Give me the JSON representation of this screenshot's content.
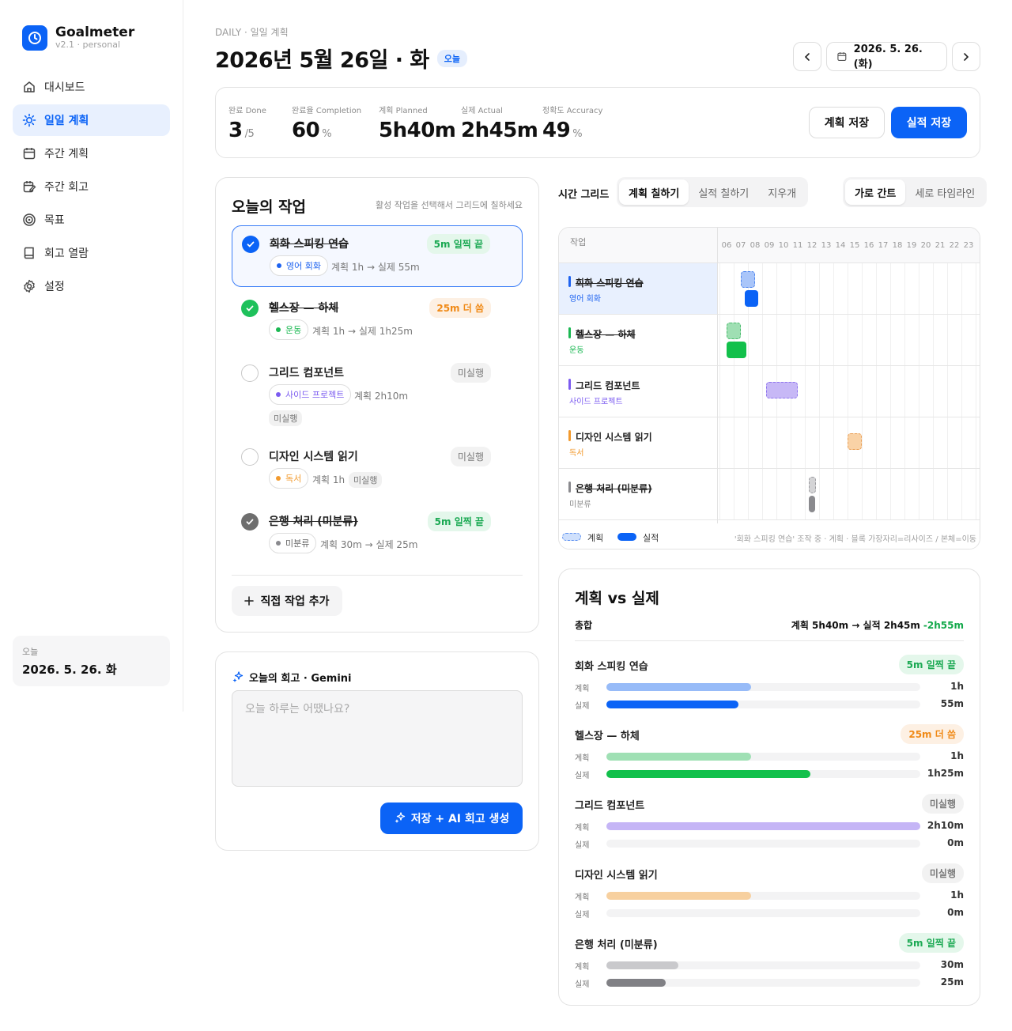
{
  "sidebar": {
    "brand": "Goalmeter",
    "version": "v2.1 · personal",
    "nav": [
      "대시보드",
      "일일 계획",
      "주간 계획",
      "주간 회고",
      "목표",
      "회고 열람",
      "설정"
    ],
    "today_label": "오늘",
    "today_date": "2026. 5. 26. 화"
  },
  "header": {
    "breadcrumb": "DAILY · 일일 계획",
    "title": "2026년 5월 26일 · 화",
    "today_pill": "오늘",
    "date_button": "2026. 5. 26. (화)"
  },
  "stats": {
    "done_label": "완료 Done",
    "done_value": "3",
    "done_total": "/5",
    "completion_label": "완료율 Completion",
    "completion_value": "60",
    "completion_unit": "%",
    "planned_label": "계획 Planned",
    "planned_value": "5h40m",
    "actual_label": "실제 Actual",
    "actual_value": "2h45m",
    "accuracy_label": "정확도 Accuracy",
    "accuracy_value": "49",
    "accuracy_unit": "%",
    "save_plan": "계획 저장",
    "save_actual": "실적 저장"
  },
  "tasks": {
    "title": "오늘의 작업",
    "hint": "활성 작업을 선택해서 그리드에 칠하세요",
    "add_button": "직접 작업 추가",
    "items": [
      {
        "name": "회화 스피킹 연습",
        "badge": "5m 일찍 끝",
        "category": "영어 회화",
        "meta": "계획 1h → 실제 55m"
      },
      {
        "name": "헬스장 — 하체",
        "badge": "25m 더 씀",
        "category": "운동",
        "meta": "계획 1h → 실제 1h25m"
      },
      {
        "name": "그리드 컴포넌트",
        "badge": "미실행",
        "category": "사이드 프로젝트",
        "meta": "계획 2h10m",
        "meta2": "미실행"
      },
      {
        "name": "디자인 시스템 읽기",
        "badge": "미실행",
        "category": "독서",
        "meta": "계획 1h",
        "meta2": "미실행"
      },
      {
        "name": "은행 처리 (미분류)",
        "badge": "5m 일찍 끝",
        "category": "미분류",
        "meta": "계획 30m → 실제 25m"
      }
    ]
  },
  "retro": {
    "title": "오늘의 회고 · Gemini",
    "placeholder": "오늘 하루는 어땠나요?",
    "button": "저장 + AI 회고 생성"
  },
  "grid": {
    "label": "시간 그리드",
    "modes": [
      "계획 칠하기",
      "실적 칠하기",
      "지우개"
    ],
    "views": [
      "가로 간트",
      "세로 타임라인"
    ],
    "task_col": "작업",
    "hours": [
      "06",
      "07",
      "08",
      "09",
      "10",
      "11",
      "12",
      "13",
      "14",
      "15",
      "16",
      "17",
      "18",
      "19",
      "20",
      "21",
      "22",
      "23"
    ],
    "legend_plan": "계획",
    "legend_actual": "실적",
    "note": "'회화 스피킹 연습' 조작 중 · 계획 · 블록 가장자리=리사이즈 / 본체=이동",
    "rows": [
      {
        "name": "회화 스피킹 연습",
        "category": "영어 회화",
        "plan": [
          7.5,
          8.5
        ],
        "actual": [
          7.75,
          8.7
        ]
      },
      {
        "name": "헬스장 — 하체",
        "category": "운동",
        "plan": [
          6.5,
          7.5
        ],
        "actual": [
          6.5,
          7.9
        ]
      },
      {
        "name": "그리드 컴포넌트",
        "category": "사이드 프로젝트",
        "plan": [
          9.25,
          11.5
        ],
        "actual": null
      },
      {
        "name": "디자인 시스템 읽기",
        "category": "독서",
        "plan": [
          15.0,
          16.0
        ],
        "actual": null
      },
      {
        "name": "은행 처리 (미분류)",
        "category": "미분류",
        "plan": [
          12.25,
          12.75
        ],
        "actual": [
          12.25,
          12.7
        ]
      }
    ]
  },
  "comparison": {
    "title": "계획 vs 실제",
    "total_label": "총합",
    "total_text": "계획 5h40m → 실적 2h45m",
    "total_diff": "-2h55m",
    "plan_label": "계획",
    "actual_label": "실제",
    "items": [
      {
        "name": "회화 스피킹 연습",
        "badge": "5m 일찍 끝",
        "plan_value": "1h",
        "actual_value": "55m",
        "plan_frac": 0.46,
        "actual_frac": 0.42
      },
      {
        "name": "헬스장 — 하체",
        "badge": "25m 더 씀",
        "plan_value": "1h",
        "actual_value": "1h25m",
        "plan_frac": 0.46,
        "actual_frac": 0.65
      },
      {
        "name": "그리드 컴포넌트",
        "badge": "미실행",
        "plan_value": "2h10m",
        "actual_value": "0m",
        "plan_frac": 1.0,
        "actual_frac": 0.0
      },
      {
        "name": "디자인 시스템 읽기",
        "badge": "미실행",
        "plan_value": "1h",
        "actual_value": "0m",
        "plan_frac": 0.46,
        "actual_frac": 0.0
      },
      {
        "name": "은행 처리 (미분류)",
        "badge": "5m 일찍 끝",
        "plan_value": "30m",
        "actual_value": "25m",
        "plan_frac": 0.23,
        "actual_frac": 0.19
      }
    ]
  },
  "colors": {
    "accent": "#0b63f6",
    "english": "#1e63f0",
    "exercise": "#1cb853",
    "side": "#7c5cf0",
    "reading": "#f29a2e",
    "misc": "#8a8a8e"
  }
}
